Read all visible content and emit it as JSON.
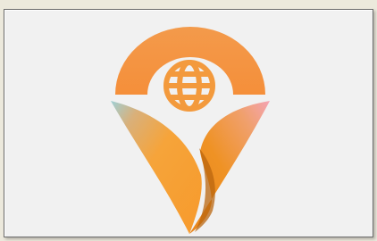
{
  "window": {
    "background": "#ece9dc",
    "panel_background": "#f1f1f1"
  },
  "logo": {
    "icon": "globe-pin-logo-icon",
    "colors": {
      "arc": "#f49a4a",
      "globe": "#f39a3d",
      "left_petal": "#f6a43a",
      "right_petal": "#e98a22",
      "accent_teal": "#8ecad2",
      "accent_pink": "#f3a6b3"
    }
  }
}
